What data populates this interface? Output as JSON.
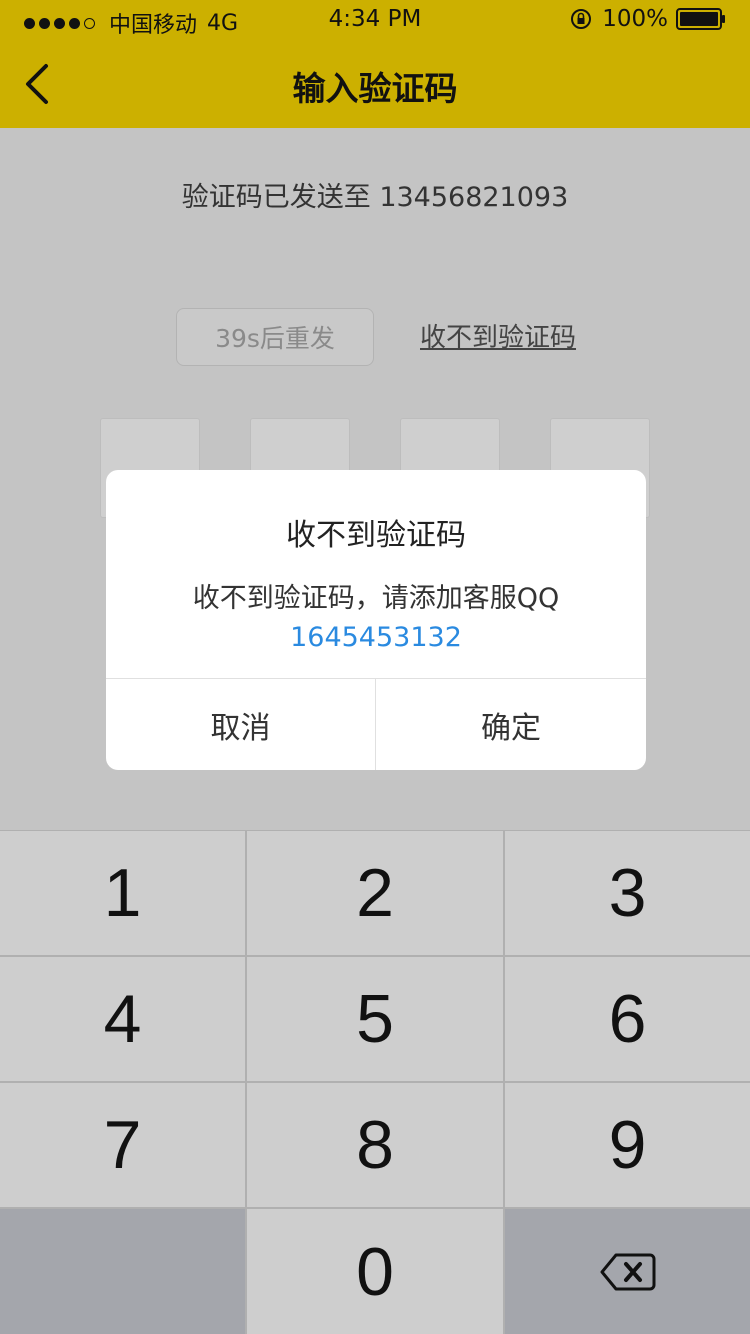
{
  "status_bar": {
    "carrier": "中国移动",
    "network": "4G",
    "time": "4:34 PM",
    "battery": "100%"
  },
  "nav": {
    "title": "输入验证码"
  },
  "main": {
    "sent_prefix": "验证码已发送至",
    "phone": "13456821093",
    "resend_label": "39s后重发",
    "cant_receive_link": "收不到验证码"
  },
  "dialog": {
    "title": "收不到验证码",
    "message": "收不到验证码，请添加客服QQ",
    "qq_number": "1645453132",
    "cancel_label": "取消",
    "ok_label": "确定"
  },
  "keypad": {
    "keys": [
      "1",
      "2",
      "3",
      "4",
      "5",
      "6",
      "7",
      "8",
      "9",
      "0"
    ]
  },
  "colors": {
    "header": "#ccb000",
    "link_blue": "#2a8ae0"
  }
}
